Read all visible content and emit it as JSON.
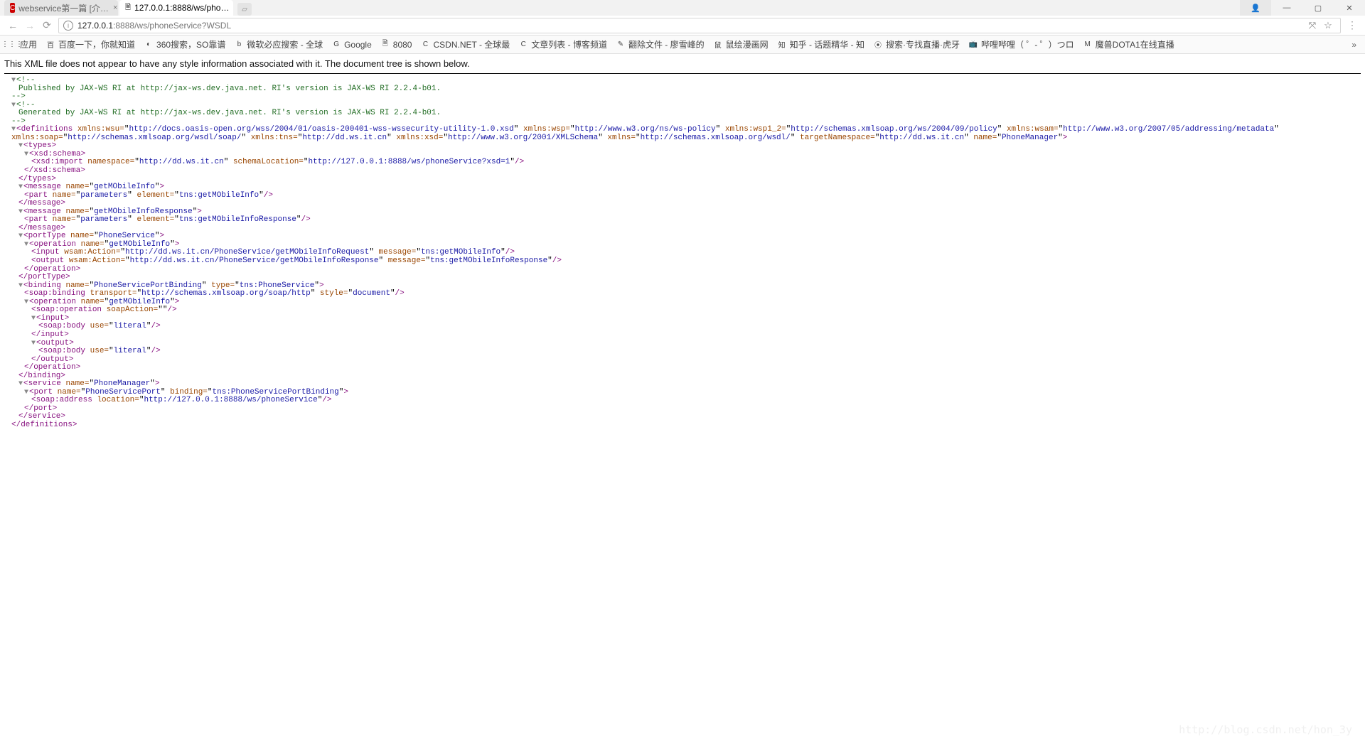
{
  "tabs": [
    {
      "title": "webservice第一篇 [介…",
      "favicon": "C"
    },
    {
      "title": "127.0.0.1:8888/ws/pho…",
      "favicon": ""
    }
  ],
  "winctrl": {
    "user": "",
    "min": "—",
    "max": "▢",
    "close": "✕"
  },
  "nav": {
    "back": "←",
    "fwd": "→",
    "reload": "⟳",
    "menu": "⋮",
    "star": "☆",
    "translate": "⤧"
  },
  "url": {
    "host": "127.0.0.1",
    "rest": ":8888/ws/phoneService?WSDL"
  },
  "bookmarks": [
    {
      "icon": "⋮⋮⋮",
      "label": "应用"
    },
    {
      "icon": "百",
      "label": "百度一下，你就知道"
    },
    {
      "icon": "◐",
      "label": "360搜索，SO靠谱"
    },
    {
      "icon": "b",
      "label": "微软必应搜索 - 全球"
    },
    {
      "icon": "G",
      "label": "Google"
    },
    {
      "icon": "🗎",
      "label": "8080"
    },
    {
      "icon": "C",
      "label": "CSDN.NET - 全球最"
    },
    {
      "icon": "C",
      "label": "文章列表 - 博客频道"
    },
    {
      "icon": "✎",
      "label": "翻除文件 - 廖雪峰的"
    },
    {
      "icon": "鼠",
      "label": "鼠绘漫画网"
    },
    {
      "icon": "知",
      "label": "知乎 - 话题精华 - 知"
    },
    {
      "icon": "⦿",
      "label": "搜索·专找直播·虎牙"
    },
    {
      "icon": "📺",
      "label": "哔哩哔哩（ ゜- ゜）つロ"
    },
    {
      "icon": "M",
      "label": "魔兽DOTA1在线直播"
    }
  ],
  "bmk_more": "»",
  "xml_msg": "This XML file does not appear to have any style information associated with it. The document tree is shown below.",
  "xml": {
    "c1": "<!--",
    "c1b": " Published by JAX-WS RI at http://jax-ws.dev.java.net. RI's version is JAX-WS RI 2.2.4-b01. ",
    "c1c": "-->",
    "c2": "<!--",
    "c2b": " Generated by JAX-WS RI at http://jax-ws.dev.java.net. RI's version is JAX-WS RI 2.2.4-b01. ",
    "c2c": "-->",
    "def_open_1": "<definitions ",
    "def_attrs": [
      [
        "xmlns:wsu",
        "http://docs.oasis-open.org/wss/2004/01/oasis-200401-wss-wssecurity-utility-1.0.xsd"
      ],
      [
        "xmlns:wsp",
        "http://www.w3.org/ns/ws-policy"
      ],
      [
        "xmlns:wsp1_2",
        "http://schemas.xmlsoap.org/ws/2004/09/policy"
      ],
      [
        "xmlns:wsam",
        "http://www.w3.org/2007/05/addressing/metadata"
      ]
    ],
    "def_attrs2": [
      [
        "xmlns:soap",
        "http://schemas.xmlsoap.org/wsdl/soap/"
      ],
      [
        "xmlns:tns",
        "http://dd.ws.it.cn"
      ],
      [
        "xmlns:xsd",
        "http://www.w3.org/2001/XMLSchema"
      ],
      [
        "xmlns",
        "http://schemas.xmlsoap.org/wsdl/"
      ],
      [
        "targetNamespace",
        "http://dd.ws.it.cn"
      ],
      [
        "name",
        "PhoneManager"
      ]
    ],
    "types_o": "<types>",
    "xsd_schema_o": "<xsd:schema>",
    "xsd_import_a": [
      [
        "namespace",
        "http://dd.ws.it.cn"
      ],
      [
        "schemaLocation",
        "http://127.0.0.1:8888/ws/phoneService?xsd=1"
      ]
    ],
    "xsd_schema_c": "</xsd:schema>",
    "types_c": "</types>",
    "msg1": [
      [
        "name",
        "getMObileInfo"
      ]
    ],
    "part1": [
      [
        "name",
        "parameters"
      ],
      [
        "element",
        "tns:getMObileInfo"
      ]
    ],
    "msg_c": "</message>",
    "msg2": [
      [
        "name",
        "getMObileInfoResponse"
      ]
    ],
    "part2": [
      [
        "name",
        "parameters"
      ],
      [
        "element",
        "tns:getMObileInfoResponse"
      ]
    ],
    "pt": [
      [
        "name",
        "PhoneService"
      ]
    ],
    "op1": [
      [
        "name",
        "getMObileInfo"
      ]
    ],
    "in1": [
      [
        "wsam:Action",
        "http://dd.ws.it.cn/PhoneService/getMObileInfoRequest"
      ],
      [
        "message",
        "tns:getMObileInfo"
      ]
    ],
    "out1": [
      [
        "wsam:Action",
        "http://dd.ws.it.cn/PhoneService/getMObileInfoResponse"
      ],
      [
        "message",
        "tns:getMObileInfoResponse"
      ]
    ],
    "op_c": "</operation>",
    "pt_c": "</portType>",
    "bind": [
      [
        "name",
        "PhoneServicePortBinding"
      ],
      [
        "type",
        "tns:PhoneService"
      ]
    ],
    "sbind": [
      [
        "transport",
        "http://schemas.xmlsoap.org/soap/http"
      ],
      [
        "style",
        "document"
      ]
    ],
    "op2": [
      [
        "name",
        "getMObileInfo"
      ]
    ],
    "sop": [
      [
        "soapAction",
        ""
      ]
    ],
    "in_o": "<input>",
    "sbody": [
      [
        "use",
        "literal"
      ]
    ],
    "in_c": "</input>",
    "out_o": "<output>",
    "out_c": "</output>",
    "bind_c": "</binding>",
    "svc": [
      [
        "name",
        "PhoneManager"
      ]
    ],
    "port": [
      [
        "name",
        "PhoneServicePort"
      ],
      [
        "binding",
        "tns:PhoneServicePortBinding"
      ]
    ],
    "saddr": [
      [
        "location",
        "http://127.0.0.1:8888/ws/phoneService"
      ]
    ],
    "port_c": "</port>",
    "svc_c": "</service>",
    "def_c": "</definitions>"
  },
  "watermark": "http://blog.csdn.net/hon_3y"
}
